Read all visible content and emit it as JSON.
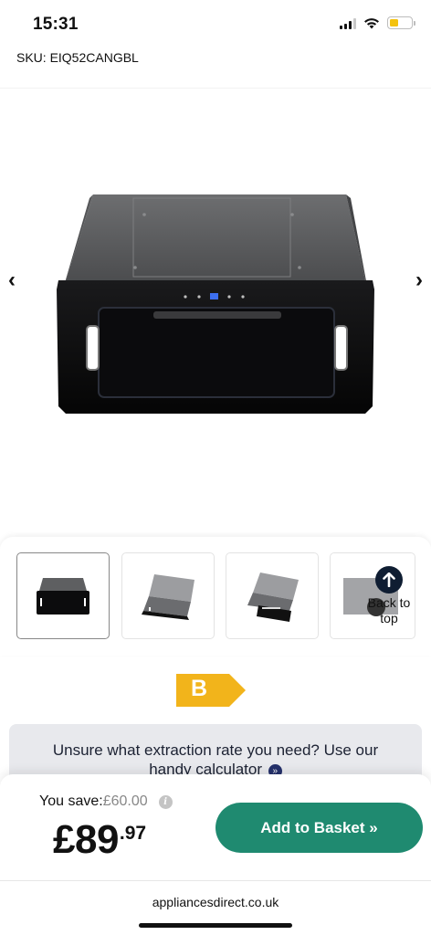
{
  "status_bar": {
    "time": "15:31"
  },
  "product": {
    "sku": "SKU: EIQ52CANGBL",
    "energy_rating": "B"
  },
  "gallery": {
    "prev_icon": "chevron-left-icon",
    "next_icon": "chevron-right-icon",
    "thumbnails": [
      {
        "alt": "canopy-front-black"
      },
      {
        "alt": "canopy-angle-grey"
      },
      {
        "alt": "canopy-angle-grey-2"
      },
      {
        "alt": "canopy-side-partial"
      }
    ]
  },
  "back_to_top": {
    "label": "Back to top"
  },
  "calculator_banner": {
    "text_line1": "Unsure what extraction rate you need? Use our",
    "text_line2": "handy calculator",
    "icon": "double-chevron-right-icon"
  },
  "pricing": {
    "save_label": "You save:",
    "save_amount": "£60.00",
    "price_main": "£89",
    "price_pence": ".97"
  },
  "cta": {
    "add_to_basket": "Add to Basket »"
  },
  "browser": {
    "domain": "appliancesdirect.co.uk"
  },
  "colors": {
    "primary_button": "#1f8a70",
    "energy_label": "#f2b41b",
    "back_to_top_bg": "#0f1d32",
    "banner_bg": "#e8e9ed"
  }
}
